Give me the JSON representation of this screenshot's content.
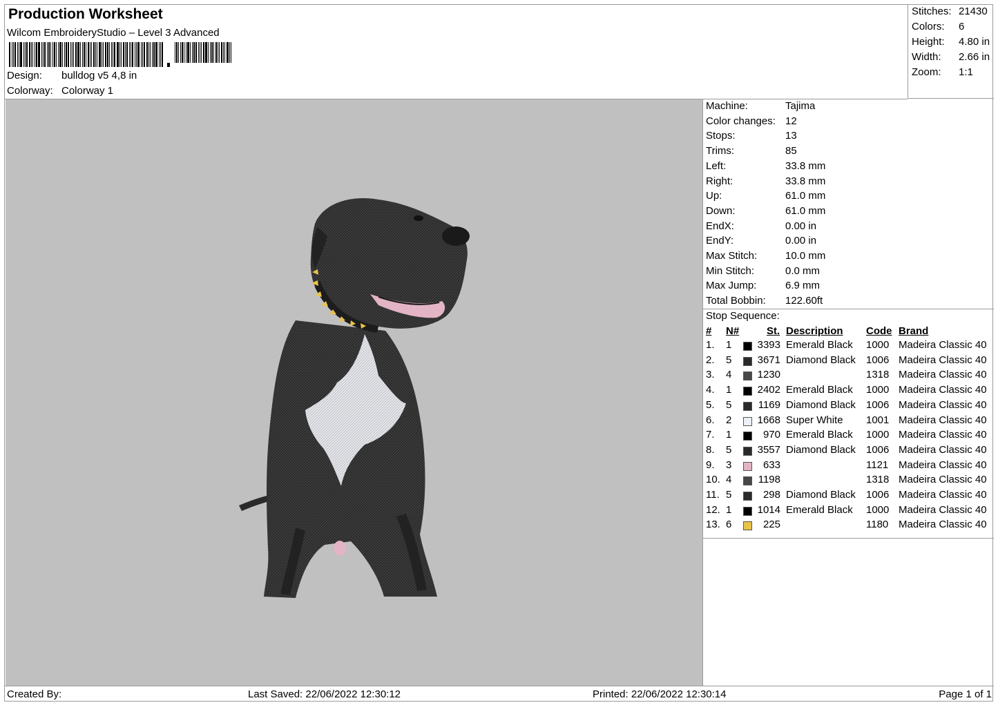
{
  "header": {
    "title": "Production Worksheet",
    "subtitle": "Wilcom EmbroideryStudio – Level 3 Advanced",
    "design_label": "Design:",
    "design_value": "bulldog v5 4,8 in",
    "colorway_label": "Colorway:",
    "colorway_value": "Colorway 1"
  },
  "stats": [
    {
      "label": "Stitches:",
      "value": "21430"
    },
    {
      "label": "Colors:",
      "value": "6"
    },
    {
      "label": "Height:",
      "value": "4.80 in"
    },
    {
      "label": "Width:",
      "value": "2.66 in"
    },
    {
      "label": "Zoom:",
      "value": "1:1"
    }
  ],
  "machine": [
    {
      "label": "Machine:",
      "value": "Tajima"
    },
    {
      "label": "Color changes:",
      "value": "12"
    },
    {
      "label": "Stops:",
      "value": "13"
    },
    {
      "label": "Trims:",
      "value": "85"
    },
    {
      "label": "Left:",
      "value": "33.8 mm"
    },
    {
      "label": "Right:",
      "value": "33.8 mm"
    },
    {
      "label": "Up:",
      "value": "61.0 mm"
    },
    {
      "label": "Down:",
      "value": "61.0 mm"
    },
    {
      "label": "EndX:",
      "value": "0.00 in"
    },
    {
      "label": "EndY:",
      "value": "0.00 in"
    },
    {
      "label": "Max Stitch:",
      "value": "10.0 mm"
    },
    {
      "label": "Min Stitch:",
      "value": "0.0 mm"
    },
    {
      "label": "Max Jump:",
      "value": "6.9 mm"
    },
    {
      "label": "Total Bobbin:",
      "value": "122.60ft"
    }
  ],
  "stop_sequence": {
    "label": "Stop Sequence:",
    "headers": {
      "num": "#",
      "n": "N#",
      "st": "St.",
      "desc": "Description",
      "code": "Code",
      "brand": "Brand"
    },
    "rows": [
      {
        "num": "1.",
        "n": "1",
        "color": "#000000",
        "st": "3393",
        "desc": "Emerald Black",
        "code": "1000",
        "brand": "Madeira Classic 40"
      },
      {
        "num": "2.",
        "n": "5",
        "color": "#2a2a2a",
        "st": "3671",
        "desc": "Diamond Black",
        "code": "1006",
        "brand": "Madeira Classic 40"
      },
      {
        "num": "3.",
        "n": "4",
        "color": "#47474a",
        "st": "1230",
        "desc": "",
        "code": "1318",
        "brand": "Madeira Classic 40"
      },
      {
        "num": "4.",
        "n": "1",
        "color": "#000000",
        "st": "2402",
        "desc": "Emerald Black",
        "code": "1000",
        "brand": "Madeira Classic 40"
      },
      {
        "num": "5.",
        "n": "5",
        "color": "#2a2a2a",
        "st": "1169",
        "desc": "Diamond Black",
        "code": "1006",
        "brand": "Madeira Classic 40"
      },
      {
        "num": "6.",
        "n": "2",
        "color": "#eef0fa",
        "st": "1668",
        "desc": "Super White",
        "code": "1001",
        "brand": "Madeira Classic 40"
      },
      {
        "num": "7.",
        "n": "1",
        "color": "#000000",
        "st": "970",
        "desc": "Emerald Black",
        "code": "1000",
        "brand": "Madeira Classic 40"
      },
      {
        "num": "8.",
        "n": "5",
        "color": "#2a2a2a",
        "st": "3557",
        "desc": "Diamond Black",
        "code": "1006",
        "brand": "Madeira Classic 40"
      },
      {
        "num": "9.",
        "n": "3",
        "color": "#e2b4c6",
        "st": "633",
        "desc": "",
        "code": "1121",
        "brand": "Madeira Classic 40"
      },
      {
        "num": "10.",
        "n": "4",
        "color": "#47474a",
        "st": "1198",
        "desc": "",
        "code": "1318",
        "brand": "Madeira Classic 40"
      },
      {
        "num": "11.",
        "n": "5",
        "color": "#2a2a2a",
        "st": "298",
        "desc": "Diamond Black",
        "code": "1006",
        "brand": "Madeira Classic 40"
      },
      {
        "num": "12.",
        "n": "1",
        "color": "#000000",
        "st": "1014",
        "desc": "Emerald Black",
        "code": "1000",
        "brand": "Madeira Classic 40"
      },
      {
        "num": "13.",
        "n": "6",
        "color": "#e8c34a",
        "st": "225",
        "desc": "",
        "code": "1180",
        "brand": "Madeira Classic 40"
      }
    ]
  },
  "footer": {
    "created_by": "Created By:",
    "last_saved": "Last Saved: 22/06/2022 12:30:12",
    "printed": "Printed: 22/06/2022 12:30:14",
    "page": "Page 1 of 1"
  }
}
